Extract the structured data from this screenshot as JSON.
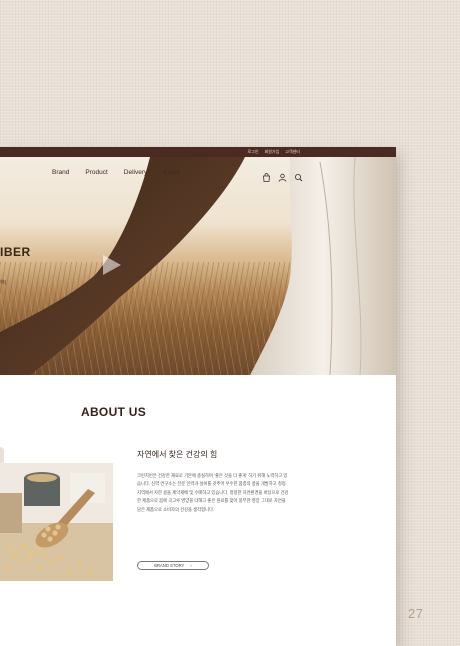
{
  "page_number": "27",
  "topbar": {
    "links": [
      "로그인",
      "회원가입",
      "고객센터"
    ]
  },
  "nav": {
    "links": [
      "Brand",
      "Product",
      "Delivery",
      "Event"
    ]
  },
  "hero": {
    "title": "IBER",
    "subtitle": "하)"
  },
  "about": {
    "title": "ABOUT US",
    "heading": "자연에서 찾은 건강의 힘",
    "body": "크런치빈은 건강한 재료로 기본에 충실하며 '좋은 것을 더 좋게' 하기 위해 노력하고 있습니다. 신력 연구소는 전문 인력과 설비를 갖추어 우수한 품종의 콩을 개발하고 청정지역에서 자란 콩을 계약재배 및 수매하고 있습니다. 청정한 자연환경을 바탕으로 건강한 제품으로 몸에 곡고루 영양을 더해고 좋은 원료를 찾아 풍부한 영양 그대로 자연을 담은 제품으로 소비자의 건강을 생각합니다.",
    "button_label": "BRAND STORY",
    "button_arrow": "›"
  },
  "icons": [
    "bag-icon",
    "user-icon",
    "search-icon",
    "play-icon"
  ]
}
